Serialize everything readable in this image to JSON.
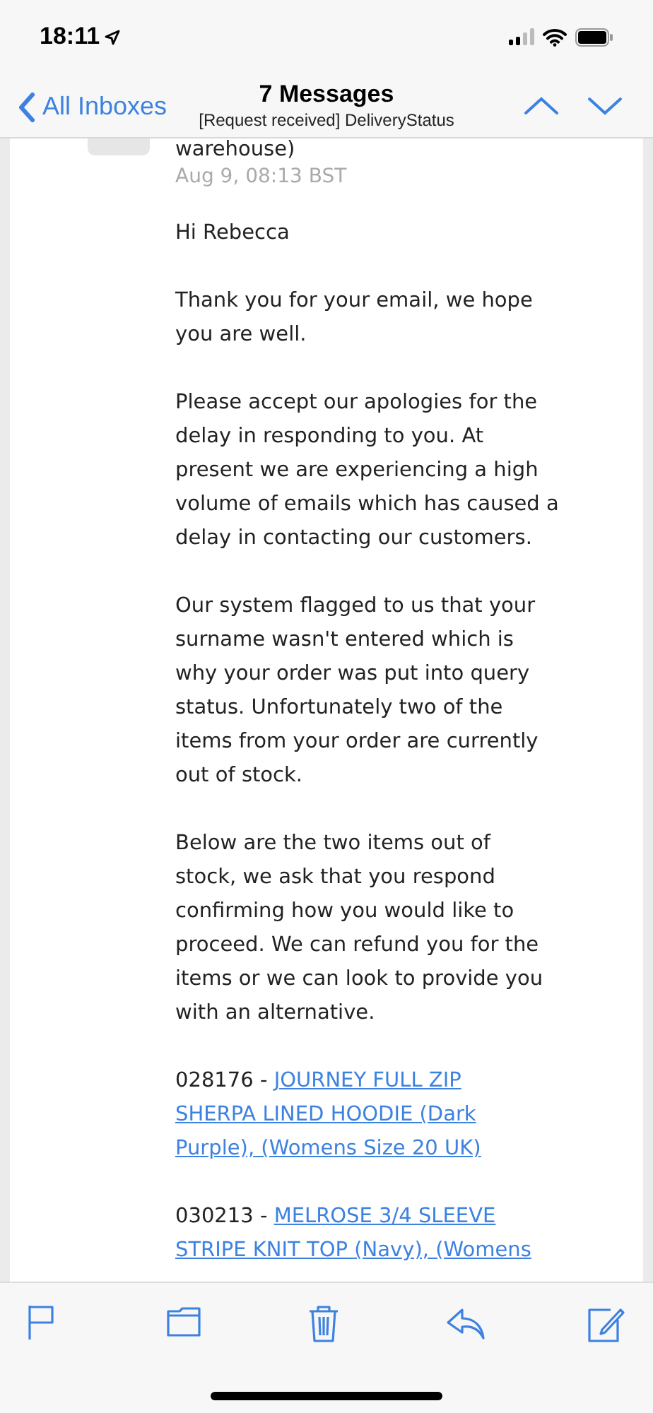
{
  "status_bar": {
    "time": "18:11"
  },
  "nav_bar": {
    "back_label": "All Inboxes",
    "title": "7 Messages",
    "subtitle": "[Request received] DeliveryStatus"
  },
  "message": {
    "sender_fragment": "warehouse)",
    "date": "Aug 9, 08:13 BST",
    "body": [
      {
        "kind": "text",
        "lines": [
          "Hi Rebecca"
        ]
      },
      {
        "kind": "text",
        "lines": [
          "Thank you for your email, we hope",
          "you are well."
        ]
      },
      {
        "kind": "text",
        "lines": [
          "Please accept our apologies for the",
          "delay in responding to you. At",
          "present we are experiencing a high",
          "volume of emails which has caused a",
          "delay in contacting our customers."
        ]
      },
      {
        "kind": "text",
        "lines": [
          "Our system flagged to us that your",
          "surname wasn't entered which is",
          "why your order was put into query",
          "status. Unfortunately two of the",
          "items from your order are currently",
          "out of stock."
        ]
      },
      {
        "kind": "text",
        "lines": [
          "Below are the two items out of",
          "stock, we ask that you respond",
          "confirming how you would like to",
          "proceed. We can refund you for the",
          "items or we can look to provide you",
          "with an alternative."
        ]
      },
      {
        "kind": "item",
        "code": "028176 - ",
        "link_lines": [
          "JOURNEY FULL ZIP",
          "SHERPA LINED HOODIE (Dark",
          "Purple), (Womens Size 20 UK)"
        ]
      },
      {
        "kind": "item",
        "code": "030213 - ",
        "link_lines": [
          "MELROSE 3/4 SLEEVE",
          "STRIPE KNIT TOP (Navy), (Womens"
        ]
      }
    ]
  },
  "toolbar": {
    "items": [
      {
        "kind": "flag"
      },
      {
        "kind": "folder"
      },
      {
        "kind": "trash"
      },
      {
        "kind": "reply"
      },
      {
        "kind": "compose"
      }
    ]
  }
}
